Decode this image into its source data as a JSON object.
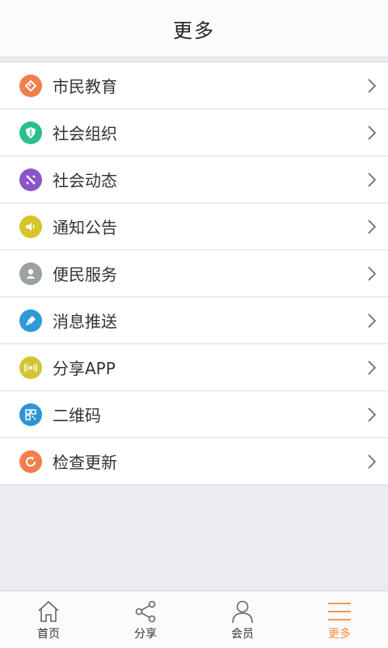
{
  "header": {
    "title": "更多"
  },
  "menu": {
    "items": [
      {
        "label": "市民教育",
        "icon": "diamond-tag-icon",
        "color": "#f07f4d"
      },
      {
        "label": "社会组织",
        "icon": "shield-icon",
        "color": "#2bbf8e"
      },
      {
        "label": "社会动态",
        "icon": "satellite-icon",
        "color": "#8a55c9"
      },
      {
        "label": "通知公告",
        "icon": "speaker-icon",
        "color": "#d6c42c"
      },
      {
        "label": "便民服务",
        "icon": "person-icon",
        "color": "#9aa3a0"
      },
      {
        "label": "消息推送",
        "icon": "brush-icon",
        "color": "#2f9ad8"
      },
      {
        "label": "分享APP",
        "icon": "broadcast-icon",
        "color": "#d2c432"
      },
      {
        "label": "二维码",
        "icon": "qr-code-icon",
        "color": "#2c95d3"
      },
      {
        "label": "检查更新",
        "icon": "refresh-icon",
        "color": "#f07f4d"
      }
    ]
  },
  "tabbar": {
    "tabs": [
      {
        "label": "首页",
        "icon": "home-icon"
      },
      {
        "label": "分享",
        "icon": "share-icon"
      },
      {
        "label": "会员",
        "icon": "user-icon"
      },
      {
        "label": "更多",
        "icon": "menu-icon",
        "active": true
      }
    ],
    "active_color": "#f08a3c"
  }
}
